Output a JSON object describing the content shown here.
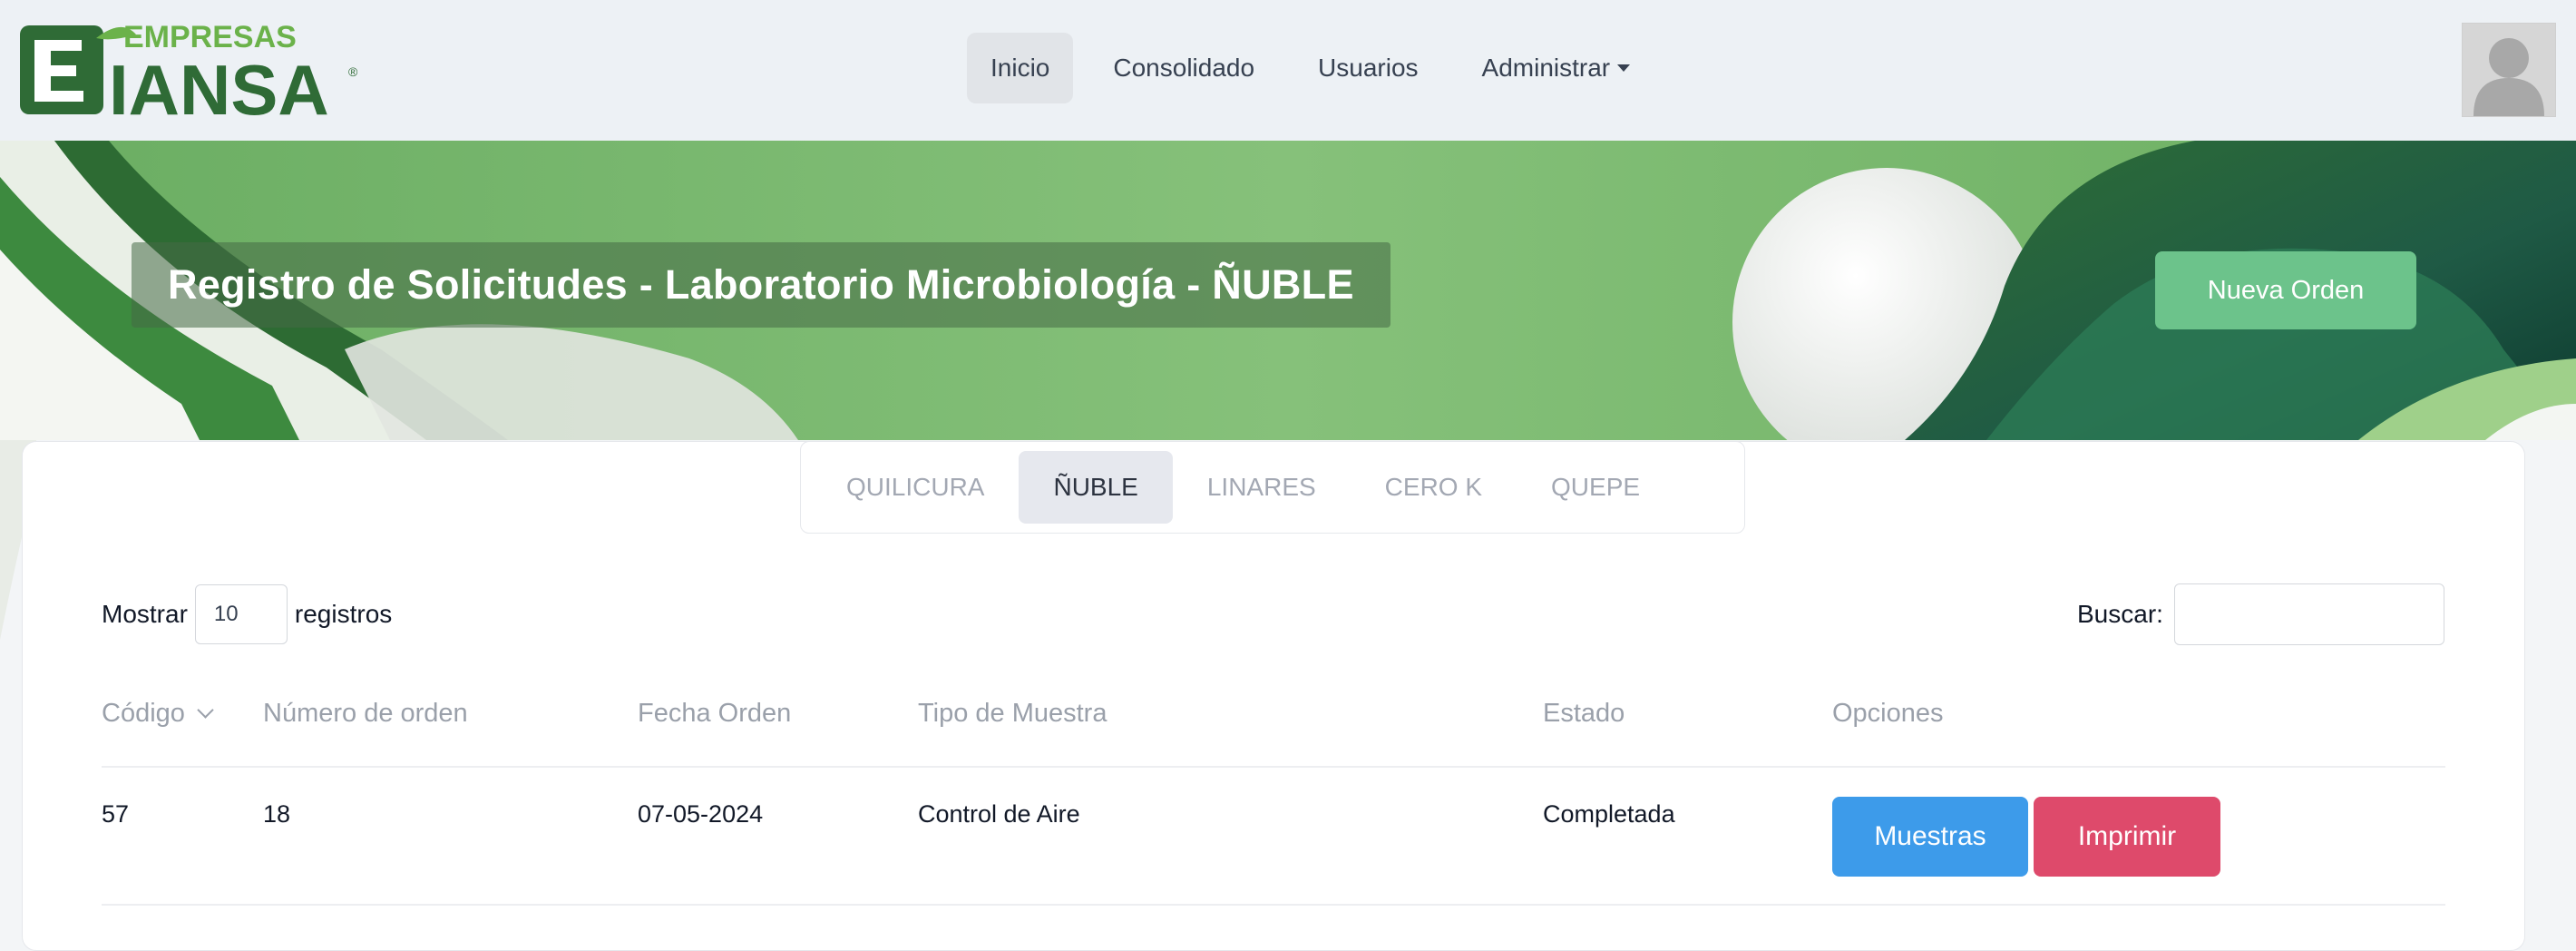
{
  "brand": {
    "top": "EMPRESAS",
    "bottom": "IANSA",
    "mark": "®"
  },
  "nav": {
    "items": [
      {
        "label": "Inicio",
        "active": true
      },
      {
        "label": "Consolidado",
        "active": false
      },
      {
        "label": "Usuarios",
        "active": false
      },
      {
        "label": "Administrar",
        "active": false,
        "dropdown": true
      }
    ]
  },
  "user": {
    "avatar_icon": "user-avatar-icon"
  },
  "banner": {
    "title": "Registro de Solicitudes - Laboratorio Microbiología - ÑUBLE",
    "new_order_label": "Nueva Orden"
  },
  "tabs": [
    {
      "label": "QUILICURA",
      "active": false
    },
    {
      "label": "ÑUBLE",
      "active": true
    },
    {
      "label": "LINARES",
      "active": false
    },
    {
      "label": "CERO K",
      "active": false
    },
    {
      "label": "QUEPE",
      "active": false
    }
  ],
  "table_controls": {
    "show_label": "Mostrar",
    "page_length": "10",
    "records_label": "registros",
    "search_label": "Buscar:",
    "search_value": ""
  },
  "table": {
    "columns": [
      "Código",
      "Número de orden",
      "Fecha Orden",
      "Tipo de Muestra",
      "Estado",
      "Opciones"
    ],
    "rows": [
      {
        "codigo": "57",
        "numero": "18",
        "fecha": "07-05-2024",
        "tipo": "Control de Aire",
        "estado": "Completada",
        "actions": {
          "samples": "Muestras",
          "print": "Imprimir"
        }
      }
    ]
  },
  "colors": {
    "brand_green": "#2f6b36",
    "brand_light_green": "#6bb24a",
    "banner_green": "#7cba6f",
    "new_order_button": "#6cc38b",
    "samples_button": "#3d9bea",
    "print_button": "#de4a6b"
  }
}
